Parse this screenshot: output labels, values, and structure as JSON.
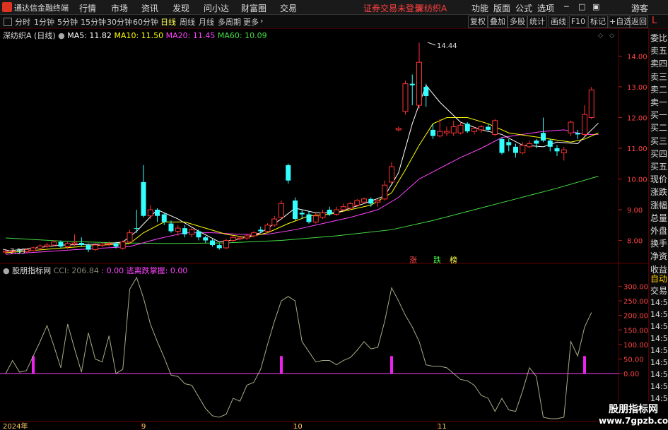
{
  "app": {
    "brand": "通达信金融终端",
    "menus": [
      "行情",
      "市场",
      "资讯",
      "发现",
      "问小达",
      "财富圈",
      "交易"
    ],
    "notice": "证券交易未登录",
    "stock_name": "深纺织A",
    "right_menus": [
      "功能",
      "版面",
      "公式",
      "选项"
    ],
    "guest": "游客"
  },
  "periods": [
    "分时",
    "1分钟",
    "5分钟",
    "15分钟",
    "30分钟",
    "60分钟",
    "日线",
    "周线",
    "月线",
    "多周期",
    "更多"
  ],
  "active_period": "日线",
  "right_buttons": [
    "复权",
    "叠加",
    "多股",
    "统计",
    "画线",
    "F10",
    "标记",
    "+自选",
    "返回"
  ],
  "main_legend": {
    "title": "深纺织A (日线)",
    "ma5": "MA5: 11.82",
    "ma10": "MA10: 11.50",
    "ma20": "MA20: 11.45",
    "ma60": "MA60: 10.09"
  },
  "colors": {
    "ma5": "#ffffff",
    "ma10": "#ffff00",
    "ma20": "#ff44ff",
    "ma60": "#44dd44",
    "up": "#ff3333",
    "down": "#33ffff"
  },
  "price_axis": [
    "14.00",
    "13.00",
    "12.00",
    "11.00",
    "10.00",
    "9.00",
    "8.00"
  ],
  "high_label": "14.44",
  "low_label": "7.39",
  "markers": {
    "zhang": "涨",
    "die": "跌",
    "bang": "榜"
  },
  "indicator_legend": {
    "title": "股朋指标网",
    "cci": "CCI: 206.84",
    "zero": ": 0.00",
    "escape": "逃离跌掌握: 0.00"
  },
  "indicator_axis": [
    "300.00",
    "250.00",
    "200.00",
    "150.00",
    "100.00",
    "50.00",
    "0.00"
  ],
  "date_labels": [
    "2024年",
    "9",
    "10",
    "11"
  ],
  "side_labels": [
    "委比",
    "卖五",
    "卖四",
    "卖三",
    "卖二",
    "卖一",
    "买一",
    "买二",
    "买三",
    "买四",
    "买五",
    "现价",
    "涨跌",
    "涨幅",
    "总量",
    "外盘",
    "换手",
    "净资",
    "收益"
  ],
  "side_bottom": [
    "自动",
    "交易"
  ],
  "time_labels": [
    "14:56",
    "14:56",
    "14:56",
    "14:56",
    "14:56",
    "14:56",
    "14:56",
    "14:56",
    "14:56",
    "14:56",
    "14:56"
  ],
  "watermark": {
    "name": "股朋指标网",
    "url": "www.7gpzb.com"
  },
  "chart_data": {
    "type": "candlestick",
    "ylim": [
      7.3,
      14.7
    ],
    "candles": [
      {
        "o": 7.62,
        "c": 7.65,
        "h": 7.72,
        "l": 7.55
      },
      {
        "o": 7.65,
        "c": 7.66,
        "h": 7.7,
        "l": 7.58
      },
      {
        "o": 7.68,
        "c": 7.66,
        "h": 7.72,
        "l": 7.6
      },
      {
        "o": 7.63,
        "c": 7.7,
        "h": 7.74,
        "l": 7.6
      },
      {
        "o": 7.67,
        "c": 7.76,
        "h": 7.8,
        "l": 7.64
      },
      {
        "o": 7.75,
        "c": 7.82,
        "h": 7.88,
        "l": 7.7
      },
      {
        "o": 7.8,
        "c": 7.85,
        "h": 7.92,
        "l": 7.75
      },
      {
        "o": 7.85,
        "c": 7.95,
        "h": 8.0,
        "l": 7.8
      },
      {
        "o": 7.95,
        "c": 7.8,
        "h": 8.0,
        "l": 7.75
      },
      {
        "o": 7.8,
        "c": 7.9,
        "h": 7.95,
        "l": 7.72
      },
      {
        "o": 7.88,
        "c": 7.92,
        "h": 8.2,
        "l": 7.82
      },
      {
        "o": 7.92,
        "c": 7.85,
        "h": 8.1,
        "l": 7.8
      },
      {
        "o": 7.85,
        "c": 7.7,
        "h": 7.9,
        "l": 7.62
      },
      {
        "o": 7.7,
        "c": 7.85,
        "h": 7.92,
        "l": 7.66
      },
      {
        "o": 7.84,
        "c": 7.88,
        "h": 7.94,
        "l": 7.78
      },
      {
        "o": 7.88,
        "c": 7.9,
        "h": 7.96,
        "l": 7.8
      },
      {
        "o": 7.9,
        "c": 7.8,
        "h": 7.95,
        "l": 7.74
      },
      {
        "o": 7.75,
        "c": 7.95,
        "h": 8.0,
        "l": 7.7
      },
      {
        "o": 7.95,
        "c": 8.25,
        "h": 8.35,
        "l": 7.9
      },
      {
        "o": 8.4,
        "c": 8.38,
        "h": 9.0,
        "l": 8.25
      },
      {
        "o": 9.9,
        "c": 8.8,
        "h": 10.45,
        "l": 8.75
      },
      {
        "o": 8.8,
        "c": 9.0,
        "h": 9.15,
        "l": 8.7
      },
      {
        "o": 9.0,
        "c": 8.8,
        "h": 9.05,
        "l": 8.6
      },
      {
        "o": 8.85,
        "c": 8.6,
        "h": 8.9,
        "l": 8.5
      },
      {
        "o": 8.55,
        "c": 8.3,
        "h": 8.65,
        "l": 8.25
      },
      {
        "o": 8.3,
        "c": 8.4,
        "h": 8.5,
        "l": 8.15
      },
      {
        "o": 8.4,
        "c": 8.2,
        "h": 8.5,
        "l": 8.1
      },
      {
        "o": 8.2,
        "c": 8.35,
        "h": 8.42,
        "l": 8.1
      },
      {
        "o": 8.3,
        "c": 8.1,
        "h": 8.35,
        "l": 8.0
      },
      {
        "o": 8.1,
        "c": 8.0,
        "h": 8.15,
        "l": 7.92
      },
      {
        "o": 8.0,
        "c": 7.85,
        "h": 8.05,
        "l": 7.8
      },
      {
        "o": 7.85,
        "c": 7.75,
        "h": 7.9,
        "l": 7.7
      },
      {
        "o": 7.76,
        "c": 8.0,
        "h": 8.05,
        "l": 7.72
      },
      {
        "o": 8.0,
        "c": 8.1,
        "h": 8.15,
        "l": 7.95
      },
      {
        "o": 8.05,
        "c": 8.08,
        "h": 8.15,
        "l": 8.0
      },
      {
        "o": 8.08,
        "c": 8.15,
        "h": 8.22,
        "l": 8.02
      },
      {
        "o": 8.15,
        "c": 8.25,
        "h": 8.3,
        "l": 8.1
      },
      {
        "o": 8.35,
        "c": 8.3,
        "h": 8.45,
        "l": 8.25
      },
      {
        "o": 8.3,
        "c": 8.5,
        "h": 8.56,
        "l": 8.25
      },
      {
        "o": 8.5,
        "c": 8.7,
        "h": 8.8,
        "l": 8.45
      },
      {
        "o": 8.75,
        "c": 9.2,
        "h": 9.3,
        "l": 8.7
      },
      {
        "o": 10.45,
        "c": 9.95,
        "h": 10.5,
        "l": 9.85
      },
      {
        "o": 9.3,
        "c": 8.7,
        "h": 9.4,
        "l": 8.65
      },
      {
        "o": 8.9,
        "c": 8.85,
        "h": 9.0,
        "l": 8.7
      },
      {
        "o": 8.85,
        "c": 8.6,
        "h": 8.95,
        "l": 8.55
      },
      {
        "o": 8.6,
        "c": 8.8,
        "h": 8.9,
        "l": 8.55
      },
      {
        "o": 8.75,
        "c": 8.9,
        "h": 9.0,
        "l": 8.7
      },
      {
        "o": 9.0,
        "c": 8.85,
        "h": 9.1,
        "l": 8.8
      },
      {
        "o": 8.85,
        "c": 9.0,
        "h": 9.1,
        "l": 8.8
      },
      {
        "o": 9.0,
        "c": 9.1,
        "h": 9.2,
        "l": 8.95
      },
      {
        "o": 9.05,
        "c": 9.2,
        "h": 9.25,
        "l": 9.0
      },
      {
        "o": 9.15,
        "c": 9.3,
        "h": 9.35,
        "l": 9.1
      },
      {
        "o": 9.25,
        "c": 9.35,
        "h": 9.4,
        "l": 9.2
      },
      {
        "o": 9.35,
        "c": 9.2,
        "h": 9.4,
        "l": 9.1
      },
      {
        "o": 9.25,
        "c": 9.3,
        "h": 9.35,
        "l": 9.1
      },
      {
        "o": 9.35,
        "c": 9.8,
        "h": 9.95,
        "l": 9.3
      },
      {
        "o": 9.9,
        "c": 10.4,
        "h": 10.55,
        "l": 9.85
      },
      {
        "o": 11.6,
        "c": 11.65,
        "h": 11.7,
        "l": 11.55
      },
      {
        "o": 12.2,
        "c": 13.1,
        "h": 13.2,
        "l": 12.1
      },
      {
        "o": 13.1,
        "c": 13.05,
        "h": 13.4,
        "l": 12.4
      },
      {
        "o": 12.4,
        "c": 13.8,
        "h": 14.44,
        "l": 12.3
      },
      {
        "o": 13.0,
        "c": 12.7,
        "h": 13.1,
        "l": 12.35
      },
      {
        "o": 11.6,
        "c": 11.4,
        "h": 11.8,
        "l": 11.3
      },
      {
        "o": 11.4,
        "c": 11.55,
        "h": 11.95,
        "l": 11.35
      },
      {
        "o": 11.5,
        "c": 11.55,
        "h": 11.7,
        "l": 11.4
      },
      {
        "o": 11.5,
        "c": 11.7,
        "h": 11.9,
        "l": 11.4
      },
      {
        "o": 11.5,
        "c": 11.75,
        "h": 11.85,
        "l": 11.45
      },
      {
        "o": 11.8,
        "c": 11.55,
        "h": 11.85,
        "l": 11.5
      },
      {
        "o": 11.55,
        "c": 11.65,
        "h": 11.7,
        "l": 11.45
      },
      {
        "o": 11.6,
        "c": 11.7,
        "h": 11.75,
        "l": 11.5
      },
      {
        "o": 11.7,
        "c": 11.6,
        "h": 11.8,
        "l": 11.55
      },
      {
        "o": 11.45,
        "c": 11.9,
        "h": 11.95,
        "l": 11.4
      },
      {
        "o": 11.3,
        "c": 10.85,
        "h": 11.35,
        "l": 10.8
      },
      {
        "o": 11.2,
        "c": 11.1,
        "h": 11.3,
        "l": 10.9
      },
      {
        "o": 11.05,
        "c": 10.85,
        "h": 11.15,
        "l": 10.7
      },
      {
        "o": 10.85,
        "c": 11.1,
        "h": 11.2,
        "l": 10.8
      },
      {
        "o": 11.05,
        "c": 11.15,
        "h": 11.25,
        "l": 11.0
      },
      {
        "o": 11.25,
        "c": 11.15,
        "h": 11.3,
        "l": 11.0
      },
      {
        "o": 11.5,
        "c": 11.25,
        "h": 12.0,
        "l": 11.2
      },
      {
        "o": 11.25,
        "c": 11.05,
        "h": 11.3,
        "l": 10.9
      },
      {
        "o": 11.0,
        "c": 10.9,
        "h": 11.1,
        "l": 10.75
      },
      {
        "o": 10.85,
        "c": 10.95,
        "h": 11.05,
        "l": 10.6
      },
      {
        "o": 11.5,
        "c": 11.85,
        "h": 11.9,
        "l": 11.4
      },
      {
        "o": 11.5,
        "c": 11.45,
        "h": 11.6,
        "l": 11.3
      },
      {
        "o": 11.45,
        "c": 12.1,
        "h": 12.4,
        "l": 11.4
      },
      {
        "o": 12.0,
        "c": 12.9,
        "h": 13.0,
        "l": 11.95
      }
    ],
    "ma5": [
      [
        0,
        7.65
      ],
      [
        8,
        7.85
      ],
      [
        14,
        7.88
      ],
      [
        17,
        7.95
      ],
      [
        19,
        8.3
      ],
      [
        22,
        9.0
      ],
      [
        25,
        8.7
      ],
      [
        28,
        8.3
      ],
      [
        31,
        7.95
      ],
      [
        34,
        8.05
      ],
      [
        37,
        8.25
      ],
      [
        40,
        8.7
      ],
      [
        42,
        9.05
      ],
      [
        45,
        8.9
      ],
      [
        48,
        8.9
      ],
      [
        52,
        9.2
      ],
      [
        55,
        9.45
      ],
      [
        57,
        10.2
      ],
      [
        59,
        11.8
      ],
      [
        61,
        13.05
      ],
      [
        63,
        12.5
      ],
      [
        66,
        11.85
      ],
      [
        69,
        11.6
      ],
      [
        72,
        11.45
      ],
      [
        75,
        11.1
      ],
      [
        78,
        11.05
      ],
      [
        80,
        11.2
      ],
      [
        83,
        11.15
      ],
      [
        86,
        11.82
      ]
    ],
    "ma10": [
      [
        0,
        7.6
      ],
      [
        8,
        7.75
      ],
      [
        14,
        7.85
      ],
      [
        18,
        7.9
      ],
      [
        20,
        8.25
      ],
      [
        23,
        8.6
      ],
      [
        26,
        8.6
      ],
      [
        29,
        8.4
      ],
      [
        32,
        8.2
      ],
      [
        35,
        8.1
      ],
      [
        38,
        8.25
      ],
      [
        41,
        8.55
      ],
      [
        44,
        8.8
      ],
      [
        47,
        8.85
      ],
      [
        50,
        9.0
      ],
      [
        53,
        9.15
      ],
      [
        56,
        9.55
      ],
      [
        58,
        10.3
      ],
      [
        60,
        11.1
      ],
      [
        62,
        11.8
      ],
      [
        64,
        12.0
      ],
      [
        67,
        12.0
      ],
      [
        70,
        11.8
      ],
      [
        73,
        11.5
      ],
      [
        76,
        11.4
      ],
      [
        79,
        11.3
      ],
      [
        82,
        11.2
      ],
      [
        84,
        11.3
      ],
      [
        86,
        11.5
      ]
    ],
    "ma20": [
      [
        0,
        7.55
      ],
      [
        10,
        7.7
      ],
      [
        18,
        7.8
      ],
      [
        22,
        8.05
      ],
      [
        26,
        8.25
      ],
      [
        30,
        8.25
      ],
      [
        34,
        8.2
      ],
      [
        38,
        8.2
      ],
      [
        42,
        8.35
      ],
      [
        46,
        8.55
      ],
      [
        50,
        8.75
      ],
      [
        54,
        9.0
      ],
      [
        57,
        9.4
      ],
      [
        60,
        10.0
      ],
      [
        63,
        10.35
      ],
      [
        66,
        10.7
      ],
      [
        69,
        11.0
      ],
      [
        72,
        11.35
      ],
      [
        75,
        11.45
      ],
      [
        78,
        11.55
      ],
      [
        81,
        11.6
      ],
      [
        84,
        11.45
      ],
      [
        86,
        11.45
      ]
    ],
    "ma60": [
      [
        0,
        8.08
      ],
      [
        8,
        7.98
      ],
      [
        16,
        7.92
      ],
      [
        24,
        7.9
      ],
      [
        32,
        7.92
      ],
      [
        40,
        8.0
      ],
      [
        48,
        8.15
      ],
      [
        56,
        8.35
      ],
      [
        62,
        8.65
      ],
      [
        68,
        9.0
      ],
      [
        74,
        9.35
      ],
      [
        80,
        9.7
      ],
      [
        86,
        10.09
      ]
    ],
    "cci": [
      [
        0,
        0
      ],
      [
        1,
        45
      ],
      [
        2,
        5
      ],
      [
        3,
        10
      ],
      [
        4,
        60
      ],
      [
        5,
        110
      ],
      [
        6,
        165
      ],
      [
        7,
        95
      ],
      [
        8,
        20
      ],
      [
        9,
        170
      ],
      [
        10,
        85
      ],
      [
        11,
        5
      ],
      [
        12,
        140
      ],
      [
        13,
        50
      ],
      [
        14,
        40
      ],
      [
        15,
        130
      ],
      [
        16,
        0
      ],
      [
        17,
        15
      ],
      [
        18,
        290
      ],
      [
        19,
        330
      ],
      [
        20,
        260
      ],
      [
        21,
        170
      ],
      [
        22,
        110
      ],
      [
        23,
        55
      ],
      [
        24,
        -5
      ],
      [
        25,
        -10
      ],
      [
        26,
        -35
      ],
      [
        27,
        -40
      ],
      [
        28,
        -80
      ],
      [
        29,
        -120
      ],
      [
        30,
        -145
      ],
      [
        31,
        -150
      ],
      [
        32,
        -140
      ],
      [
        33,
        -85
      ],
      [
        34,
        -95
      ],
      [
        35,
        -40
      ],
      [
        36,
        -30
      ],
      [
        37,
        15
      ],
      [
        38,
        100
      ],
      [
        39,
        180
      ],
      [
        40,
        250
      ],
      [
        41,
        265
      ],
      [
        42,
        250
      ],
      [
        43,
        110
      ],
      [
        44,
        75
      ],
      [
        45,
        40
      ],
      [
        46,
        45
      ],
      [
        47,
        45
      ],
      [
        48,
        30
      ],
      [
        49,
        45
      ],
      [
        50,
        55
      ],
      [
        51,
        80
      ],
      [
        52,
        110
      ],
      [
        53,
        85
      ],
      [
        54,
        90
      ],
      [
        55,
        180
      ],
      [
        56,
        295
      ],
      [
        57,
        250
      ],
      [
        58,
        200
      ],
      [
        59,
        160
      ],
      [
        60,
        110
      ],
      [
        61,
        30
      ],
      [
        62,
        25
      ],
      [
        63,
        25
      ],
      [
        64,
        20
      ],
      [
        65,
        0
      ],
      [
        66,
        -20
      ],
      [
        67,
        -25
      ],
      [
        68,
        -40
      ],
      [
        69,
        -75
      ],
      [
        70,
        -85
      ],
      [
        71,
        -130
      ],
      [
        72,
        -85
      ],
      [
        73,
        -125
      ],
      [
        74,
        -130
      ],
      [
        75,
        -60
      ],
      [
        76,
        20
      ],
      [
        77,
        -10
      ],
      [
        78,
        -150
      ],
      [
        79,
        -155
      ],
      [
        80,
        -155
      ],
      [
        81,
        -150
      ],
      [
        82,
        110
      ],
      [
        83,
        60
      ],
      [
        84,
        160
      ],
      [
        85,
        210
      ]
    ],
    "signals": [
      4,
      40,
      56,
      84
    ],
    "cci_ylim": [
      -160,
      340
    ]
  }
}
